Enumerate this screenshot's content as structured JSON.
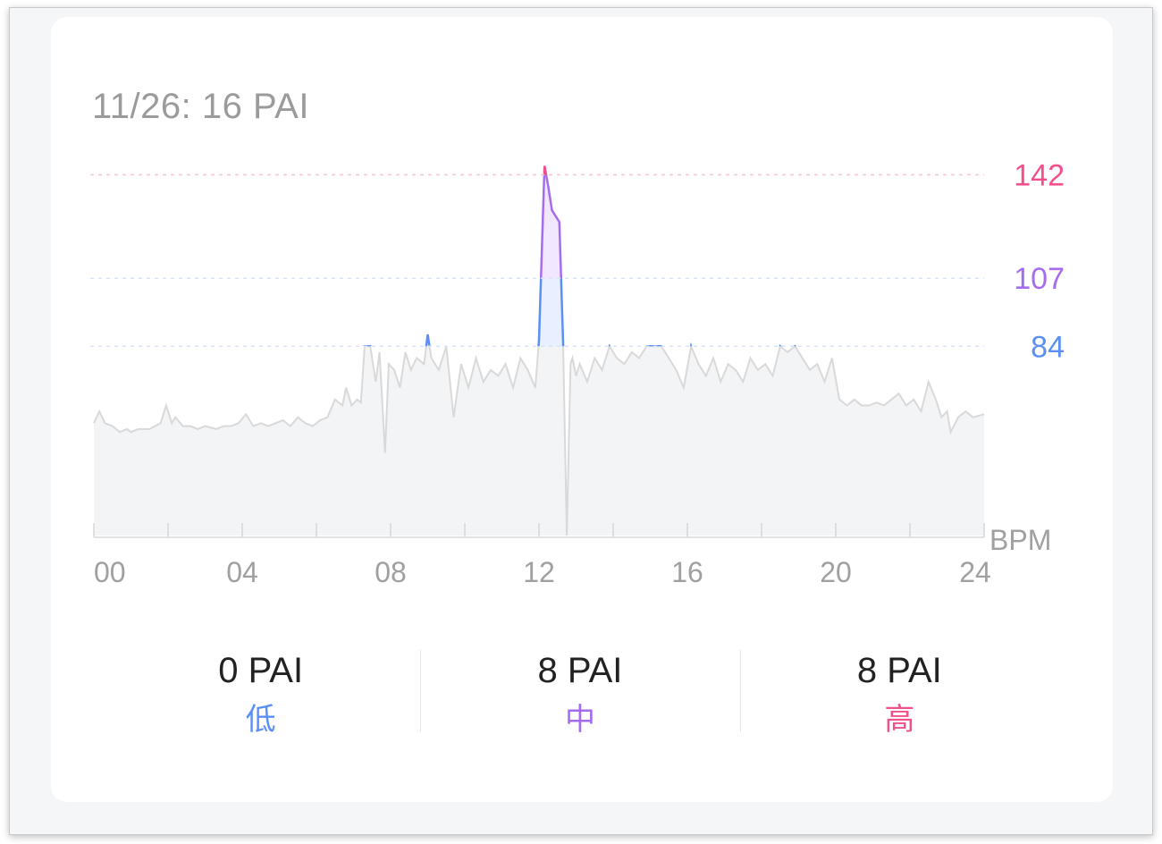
{
  "card": {
    "title": "11/26: 16 PAI"
  },
  "stats": [
    {
      "value": "0 PAI",
      "label": "低",
      "color": "#5b8ff5"
    },
    {
      "value": "8 PAI",
      "label": "中",
      "color": "#a66cf0"
    },
    {
      "value": "8 PAI",
      "label": "高",
      "color": "#f2508c"
    }
  ],
  "colors": {
    "low": "#5b8ff5",
    "mid": "#a66cf0",
    "high": "#f2508c",
    "base_line": "#d9d9d9",
    "area_fill": "#f3f4f6",
    "axis_text": "#a0a0a0"
  },
  "chart_data": {
    "type": "area",
    "title": "",
    "xlabel": "",
    "ylabel": "BPM",
    "x_range": [
      0,
      24
    ],
    "x_ticks": [
      "00",
      "04",
      "08",
      "12",
      "16",
      "20",
      "24"
    ],
    "x_tick_values": [
      0,
      4,
      8,
      12,
      16,
      20,
      24
    ],
    "y_range": [
      20,
      150
    ],
    "thresholds": [
      {
        "label": "142",
        "value": 142,
        "color_key": "high"
      },
      {
        "label": "107",
        "value": 107,
        "color_key": "mid"
      },
      {
        "label": "84",
        "value": 84,
        "color_key": "low"
      }
    ],
    "series": [
      {
        "x": [
          0.0,
          0.15,
          0.3,
          0.5,
          0.7,
          0.9,
          1.0,
          1.2,
          1.5,
          1.8,
          1.95,
          2.1,
          2.2,
          2.4,
          2.6,
          2.8,
          3.0,
          3.3,
          3.5,
          3.7,
          3.9,
          4.1,
          4.3,
          4.5,
          4.7,
          4.9,
          5.1,
          5.3,
          5.5,
          5.7,
          5.9,
          6.1,
          6.3,
          6.5,
          6.7,
          6.8,
          6.95,
          7.1,
          7.2,
          7.3,
          7.45,
          7.6,
          7.7,
          7.85,
          7.95,
          8.1,
          8.25,
          8.4,
          8.55,
          8.7,
          8.9,
          9.0,
          9.1,
          9.3,
          9.5,
          9.7,
          9.9,
          10.1,
          10.3,
          10.5,
          10.7,
          10.9,
          11.1,
          11.3,
          11.5,
          11.7,
          11.9,
          12.0,
          12.1,
          12.15,
          12.25,
          12.35,
          12.45,
          12.55,
          12.65,
          12.75,
          12.85,
          12.9,
          13.0,
          13.1,
          13.3,
          13.5,
          13.7,
          13.9,
          14.1,
          14.3,
          14.5,
          14.7,
          14.9,
          15.1,
          15.3,
          15.5,
          15.7,
          15.9,
          16.1,
          16.3,
          16.5,
          16.7,
          16.9,
          17.1,
          17.3,
          17.5,
          17.7,
          17.9,
          18.1,
          18.3,
          18.5,
          18.7,
          18.9,
          19.1,
          19.3,
          19.5,
          19.7,
          19.9,
          20.1,
          20.3,
          20.5,
          20.7,
          20.9,
          21.1,
          21.3,
          21.5,
          21.7,
          21.9,
          22.1,
          22.3,
          22.5,
          22.7,
          22.85,
          23.0,
          23.1,
          23.3,
          23.5,
          23.7,
          24.0
        ],
        "y": [
          58,
          62,
          58,
          57,
          55,
          56,
          55,
          56,
          56,
          58,
          64,
          58,
          60,
          57,
          57,
          56,
          57,
          56,
          57,
          57,
          58,
          61,
          57,
          58,
          57,
          58,
          59,
          57,
          60,
          58,
          57,
          59,
          60,
          66,
          64,
          70,
          64,
          66,
          65,
          84,
          84,
          72,
          82,
          48,
          78,
          76,
          70,
          82,
          76,
          80,
          78,
          88,
          80,
          76,
          84,
          60,
          78,
          70,
          80,
          72,
          76,
          74,
          78,
          70,
          80,
          76,
          70,
          86,
          125,
          145,
          138,
          130,
          128,
          126,
          85,
          20,
          78,
          80,
          74,
          78,
          72,
          80,
          76,
          84,
          80,
          78,
          82,
          80,
          84,
          84,
          84,
          80,
          76,
          70,
          84,
          78,
          74,
          80,
          72,
          78,
          76,
          72,
          80,
          76,
          78,
          74,
          84,
          82,
          84,
          80,
          76,
          78,
          72,
          80,
          66,
          64,
          66,
          64,
          64,
          65,
          64,
          66,
          68,
          64,
          66,
          62,
          72,
          66,
          60,
          62,
          55,
          60,
          62,
          60,
          61
        ]
      }
    ],
    "grid": false,
    "legend": "none"
  }
}
